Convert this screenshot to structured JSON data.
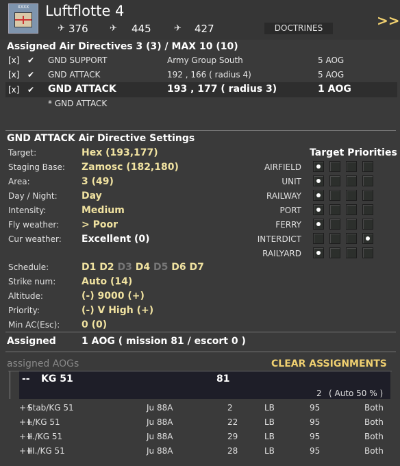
{
  "header": {
    "emblem_tag": "XXXX",
    "title": "Luftflotte 4",
    "fighters": "376",
    "bombers": "445",
    "recon": "427",
    "doctrines_label": "DOCTRINES",
    "more_label": ">>"
  },
  "directives": {
    "heading": "Assigned Air Directives 3 (3) / MAX 10 (10)",
    "rows": [
      {
        "box": "[x]",
        "name": "GND SUPPORT",
        "target": "Army Group South",
        "aog": "5 AOG"
      },
      {
        "box": "[x]",
        "name": "GND ATTACK",
        "target": "192 , 166 ( radius 4)",
        "aog": "5 AOG"
      },
      {
        "box": "[x]",
        "name": "GND ATTACK",
        "target": "193 , 177 ( radius 3)",
        "aog": "1 AOG"
      }
    ],
    "sub_item": "* GND ATTACK"
  },
  "settings": {
    "heading": "GND ATTACK Air Directive Settings",
    "fields": [
      {
        "label": "Target:",
        "value": "Hex (193,177)"
      },
      {
        "label": "Staging Base:",
        "value": "Zamosc (182,180)"
      },
      {
        "label": "Area:",
        "value": "3 (49)"
      },
      {
        "label": "Day / Night:",
        "value": "Day"
      },
      {
        "label": "Intensity:",
        "value": "Medium"
      },
      {
        "label": "Fly weather:",
        "value": "> Poor"
      },
      {
        "label": "Cur weather:",
        "value": "Excellent (0)"
      }
    ],
    "schedule_label": "Schedule:",
    "days": [
      {
        "d": "D1",
        "on": true
      },
      {
        "d": "D2",
        "on": true
      },
      {
        "d": "D3",
        "on": false
      },
      {
        "d": "D4",
        "on": true
      },
      {
        "d": "D5",
        "on": false
      },
      {
        "d": "D6",
        "on": true
      },
      {
        "d": "D7",
        "on": true
      }
    ],
    "strike_label": "Strike num:",
    "strike_value": "Auto (14)",
    "altitude_label": "Altitude:",
    "altitude_minus": "(-)",
    "altitude_value": "9000",
    "altitude_plus": "(+)",
    "priority_label": "Priority:",
    "priority_minus": "(-)",
    "priority_value": "V High",
    "priority_plus": "(+)",
    "minac_label": "Min AC(Esc):",
    "minac_value": "0 (0)"
  },
  "target_priorities": {
    "heading": "Target Priorities",
    "rows": [
      {
        "name": "AIRFIELD",
        "selected": 1
      },
      {
        "name": "UNIT",
        "selected": 1
      },
      {
        "name": "RAILWAY",
        "selected": 1
      },
      {
        "name": "PORT",
        "selected": 1
      },
      {
        "name": "FERRY",
        "selected": 1
      },
      {
        "name": "INTERDICT",
        "selected": 4
      },
      {
        "name": "RAILYARD",
        "selected": 1
      }
    ]
  },
  "assigned": {
    "label": "Assigned",
    "value": "1 AOG  ( mission 81 / escort 0 )"
  },
  "aogs": {
    "heading": "assigned AOGs",
    "clear_label": "CLEAR ASSIGNMENTS",
    "group_prefix": "--",
    "group_name": "KG 51",
    "group_id": "81",
    "group_count": "2",
    "group_auto": "( Auto 50 % )",
    "units": [
      {
        "prefix": "++",
        "name": "Stab/KG 51",
        "aircraft": "Ju 88A",
        "count": "2",
        "role": "LB",
        "exp": "95",
        "mode": "Both"
      },
      {
        "prefix": "++",
        "name": "I./KG 51",
        "aircraft": "Ju 88A",
        "count": "22",
        "role": "LB",
        "exp": "95",
        "mode": "Both"
      },
      {
        "prefix": "++",
        "name": "II./KG 51",
        "aircraft": "Ju 88A",
        "count": "29",
        "role": "LB",
        "exp": "95",
        "mode": "Both"
      },
      {
        "prefix": "++",
        "name": "III./KG 51",
        "aircraft": "Ju 88A",
        "count": "28",
        "role": "LB",
        "exp": "95",
        "mode": "Both"
      }
    ]
  },
  "colors": {
    "background": "#3a3a3a",
    "accent": "#f0d070",
    "value": "#f0e2a0"
  },
  "icons": [
    "air-hq-emblem-icon",
    "fighter-icon",
    "bomber-icon",
    "recon-plane-icon",
    "checkmark-icon",
    "radio-dot-icon"
  ]
}
